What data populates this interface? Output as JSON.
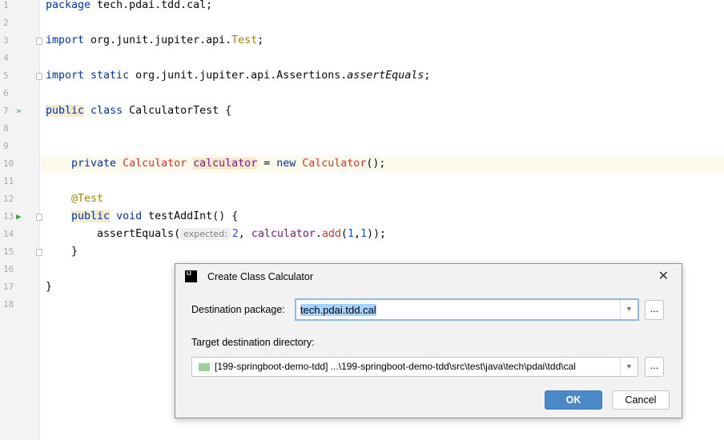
{
  "editor": {
    "lines": [
      {
        "n": "1",
        "tokens": [
          {
            "t": "package ",
            "c": "k"
          },
          {
            "t": "tech.pdai.tdd.cal;",
            "c": "s"
          }
        ]
      },
      {
        "n": "2",
        "tokens": []
      },
      {
        "n": "3",
        "tokens": [
          {
            "t": "import ",
            "c": "k"
          },
          {
            "t": "org.junit.jupiter.api.",
            "c": "s"
          },
          {
            "t": "Test",
            "c": "a"
          },
          {
            "t": ";",
            "c": "s"
          }
        ]
      },
      {
        "n": "4",
        "tokens": []
      },
      {
        "n": "5",
        "tokens": [
          {
            "t": "import static ",
            "c": "k"
          },
          {
            "t": "org.junit.jupiter.api.Assertions.",
            "c": "s"
          },
          {
            "t": "assertEquals",
            "c": "i"
          },
          {
            "t": ";",
            "c": "s"
          }
        ]
      },
      {
        "n": "6",
        "tokens": []
      },
      {
        "n": "7",
        "tokens": [
          {
            "t": "public",
            "c": "k hl"
          },
          {
            "t": " class ",
            "c": "k"
          },
          {
            "t": "CalculatorTest {",
            "c": "s"
          }
        ]
      },
      {
        "n": "8",
        "tokens": []
      },
      {
        "n": "9",
        "tokens": []
      },
      {
        "n": "10",
        "tokens": [
          {
            "t": "    private ",
            "c": "k"
          },
          {
            "t": "Calculator ",
            "c": "e"
          },
          {
            "t": "calculator",
            "c": "f hl"
          },
          {
            "t": " = ",
            "c": "s"
          },
          {
            "t": "new ",
            "c": "k"
          },
          {
            "t": "Calculator",
            "c": "e"
          },
          {
            "t": "();",
            "c": "s"
          }
        ]
      },
      {
        "n": "11",
        "tokens": []
      },
      {
        "n": "12",
        "tokens": [
          {
            "t": "    ",
            "c": "s"
          },
          {
            "t": "@Test",
            "c": "a"
          }
        ]
      },
      {
        "n": "13",
        "tokens": [
          {
            "t": "    ",
            "c": "s"
          },
          {
            "t": "public",
            "c": "k hl"
          },
          {
            "t": " void ",
            "c": "k"
          },
          {
            "t": "testAddInt() {",
            "c": "s"
          }
        ]
      },
      {
        "n": "14",
        "tokens": [
          {
            "t": "        assertEquals(",
            "c": "s"
          },
          {
            "t": "expected:",
            "c": "hint"
          },
          {
            "t": "2",
            "c": "n"
          },
          {
            "t": ", ",
            "c": "s"
          },
          {
            "t": "calculator",
            "c": "f"
          },
          {
            "t": ".",
            "c": "s"
          },
          {
            "t": "add",
            "c": "e"
          },
          {
            "t": "(",
            "c": "s"
          },
          {
            "t": "1",
            "c": "n"
          },
          {
            "t": ",",
            "c": "s"
          },
          {
            "t": "1",
            "c": "n"
          },
          {
            "t": "));",
            "c": "s"
          }
        ]
      },
      {
        "n": "15",
        "tokens": [
          {
            "t": "    }",
            "c": "s"
          }
        ]
      },
      {
        "n": "16",
        "tokens": []
      },
      {
        "n": "17",
        "tokens": [
          {
            "t": "}",
            "c": "s"
          }
        ]
      },
      {
        "n": "18",
        "tokens": []
      }
    ],
    "current_line": "10",
    "colors": {
      "keyword": "#0033b3",
      "unresolved": "#e0302f",
      "field": "#871094",
      "annotation": "#9e880d",
      "number": "#1750eb"
    }
  },
  "dialog": {
    "title": "Create Class Calculator",
    "package_label": "Destination package:",
    "package_value": "tech.pdai.tdd.cal",
    "dir_label": "Target destination directory:",
    "dir_value": "[199-springboot-demo-tdd] ...\\199-springboot-demo-tdd\\src\\test\\java\\tech\\pdai\\tdd\\cal",
    "browse": "...",
    "ok": "OK",
    "cancel": "Cancel",
    "ok_color": "#4a88c7"
  }
}
